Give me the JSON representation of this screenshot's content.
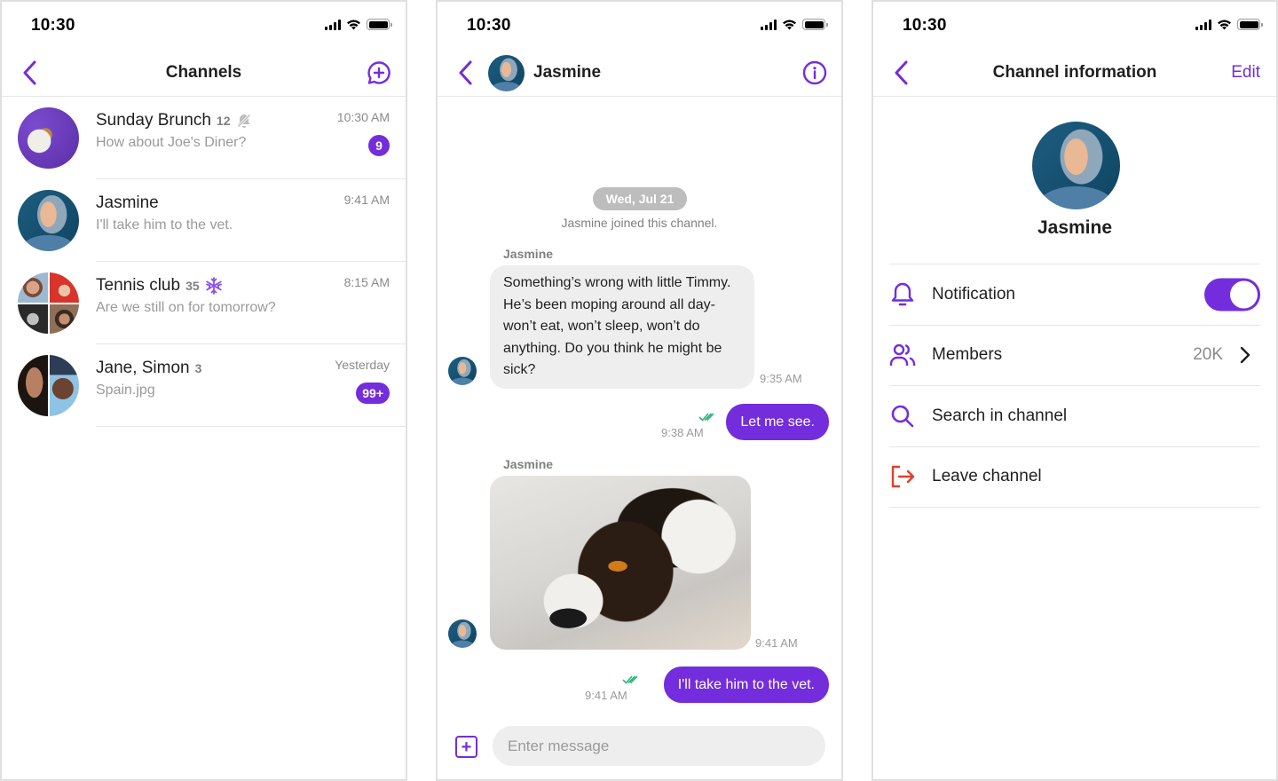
{
  "theme": {
    "accent": "#742ddd",
    "danger": "#e0402a",
    "read_check": "#2eb67d"
  },
  "status_bar": {
    "time": "10:30"
  },
  "channels_screen": {
    "title": "Channels",
    "back_icon": "chevron-left-icon",
    "new_channel_icon": "message-plus-icon",
    "channels": [
      {
        "name": "Sunday Brunch",
        "member_count": "12",
        "status_icon": "bell-off-icon",
        "last_message": "How about Joe's Diner?",
        "time": "10:30 AM",
        "unread": "9"
      },
      {
        "name": "Jasmine",
        "member_count": "",
        "status_icon": "",
        "last_message": "I'll take him to the vet.",
        "time": "9:41 AM",
        "unread": ""
      },
      {
        "name": "Tennis club",
        "member_count": "35",
        "status_icon": "snowflake-icon",
        "last_message": "Are we still on for tomorrow?",
        "time": "8:15 AM",
        "unread": ""
      },
      {
        "name": "Jane, Simon",
        "member_count": "3",
        "status_icon": "",
        "last_message": "Spain.jpg",
        "time": "Yesterday",
        "unread": "99+"
      }
    ]
  },
  "chat_screen": {
    "title": "Jasmine",
    "info_icon": "info-icon",
    "date_separator": "Wed, Jul 21",
    "system_message": "Jasmine joined this channel.",
    "messages": [
      {
        "direction": "in",
        "sender": "Jasmine",
        "type": "text",
        "text": "Something’s wrong with little Timmy. He’s been moping around all day-won’t eat, won’t sleep, won’t do anything. Do you think he might be sick?",
        "time": "9:35 AM"
      },
      {
        "direction": "out",
        "type": "text",
        "text": "Let me see.",
        "time": "9:38 AM",
        "status": "read"
      },
      {
        "direction": "in",
        "sender": "Jasmine",
        "type": "image",
        "image_alt": "Black and white dog lying on a rug",
        "time": "9:41 AM"
      },
      {
        "direction": "out",
        "type": "text",
        "text": "I'll take him to the vet.",
        "time": "9:41 AM",
        "status": "read"
      }
    ],
    "composer": {
      "placeholder": "Enter message",
      "value": "",
      "attach_icon": "plus-square-icon"
    }
  },
  "info_screen": {
    "title": "Channel information",
    "edit_label": "Edit",
    "channel_name": "Jasmine",
    "rows": [
      {
        "icon": "bell-icon",
        "label": "Notification",
        "toggle_on": true
      },
      {
        "icon": "members-icon",
        "label": "Members",
        "value": "20K"
      },
      {
        "icon": "search-icon",
        "label": "Search in channel"
      },
      {
        "icon": "leave-icon",
        "label": "Leave channel"
      }
    ]
  }
}
